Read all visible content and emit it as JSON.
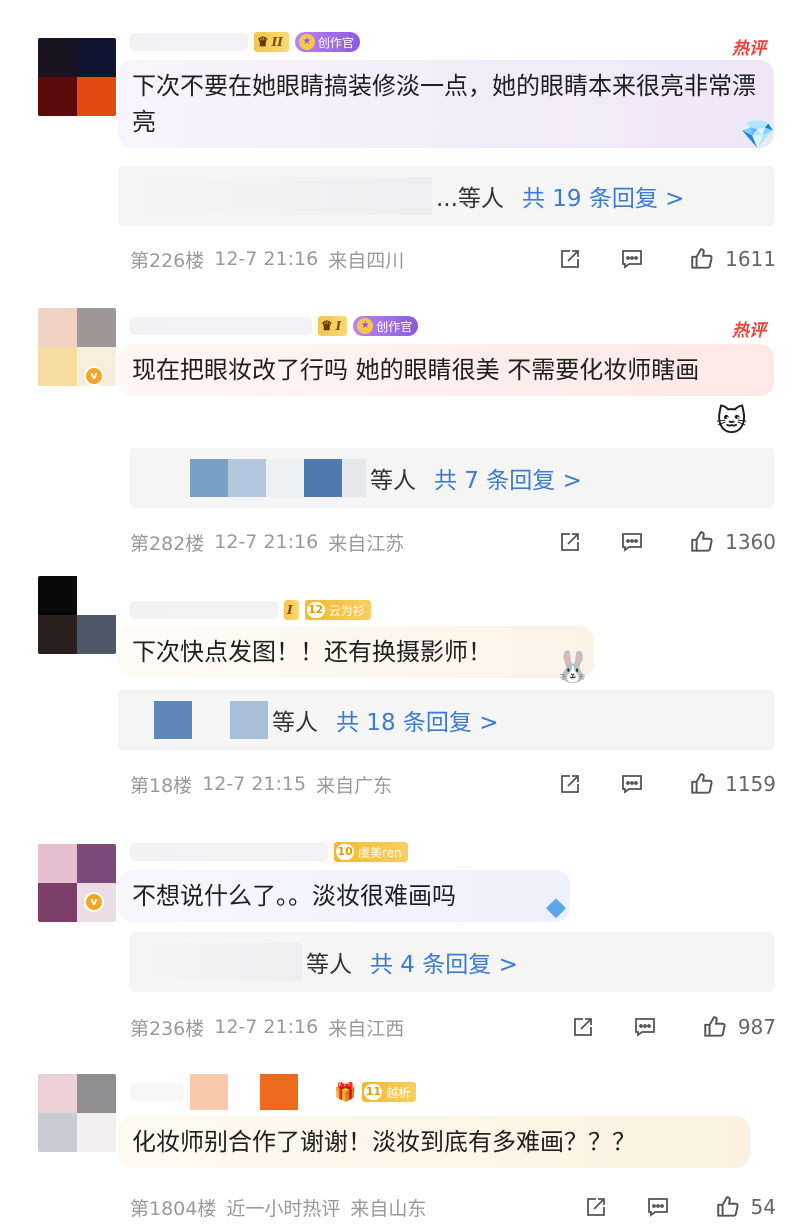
{
  "comments": [
    {
      "text": "下次不要在她眼睛搞装修淡一点，她的眼睛本来很亮非常漂亮",
      "level_badge": "II",
      "creator_badge": "创作官",
      "hot_tag": "热评",
      "reply_who": "...等人",
      "reply_count": "共 19 条回复 >",
      "floor": "第226楼",
      "time": "12-7 21:16",
      "location": "来自四川",
      "likes": "1611"
    },
    {
      "text": "现在把眼妆改了行吗  她的眼睛很美  不需要化妆师瞎画",
      "level_badge": "I",
      "creator_badge": "创作官",
      "hot_tag": "热评",
      "reply_who": "等人",
      "reply_count": "共 7 条回复 >",
      "floor": "第282楼",
      "time": "12-7 21:16",
      "location": "来自江苏",
      "likes": "1360"
    },
    {
      "text": "下次快点发图！！还有换摄影师！",
      "level_badge": "I",
      "fan_level": "12",
      "fan_name": "云为衫",
      "reply_who": "等人",
      "reply_count": "共 18 条回复 >",
      "floor": "第18楼",
      "time": "12-7 21:15",
      "location": "来自广东",
      "likes": "1159"
    },
    {
      "text": "不想说什么了。。淡妆很难画吗",
      "fan_level": "10",
      "fan_name": "虞美ren",
      "reply_who": "等人",
      "reply_count": "共 4 条回复 >",
      "floor": "第236楼",
      "time": "12-7 21:16",
      "location": "来自江西",
      "likes": "987"
    },
    {
      "text": "化妆师别合作了谢谢！淡妆到底有多难画？？？",
      "fan_level": "11",
      "fan_name": "越析",
      "floor": "第1804楼",
      "time": "近一小时热评",
      "location": "来自山东",
      "likes": "54"
    }
  ],
  "colors": {
    "accent_blue": "#3a7bd5",
    "hot_red": "#e8453c",
    "meta_gray": "#999999"
  }
}
